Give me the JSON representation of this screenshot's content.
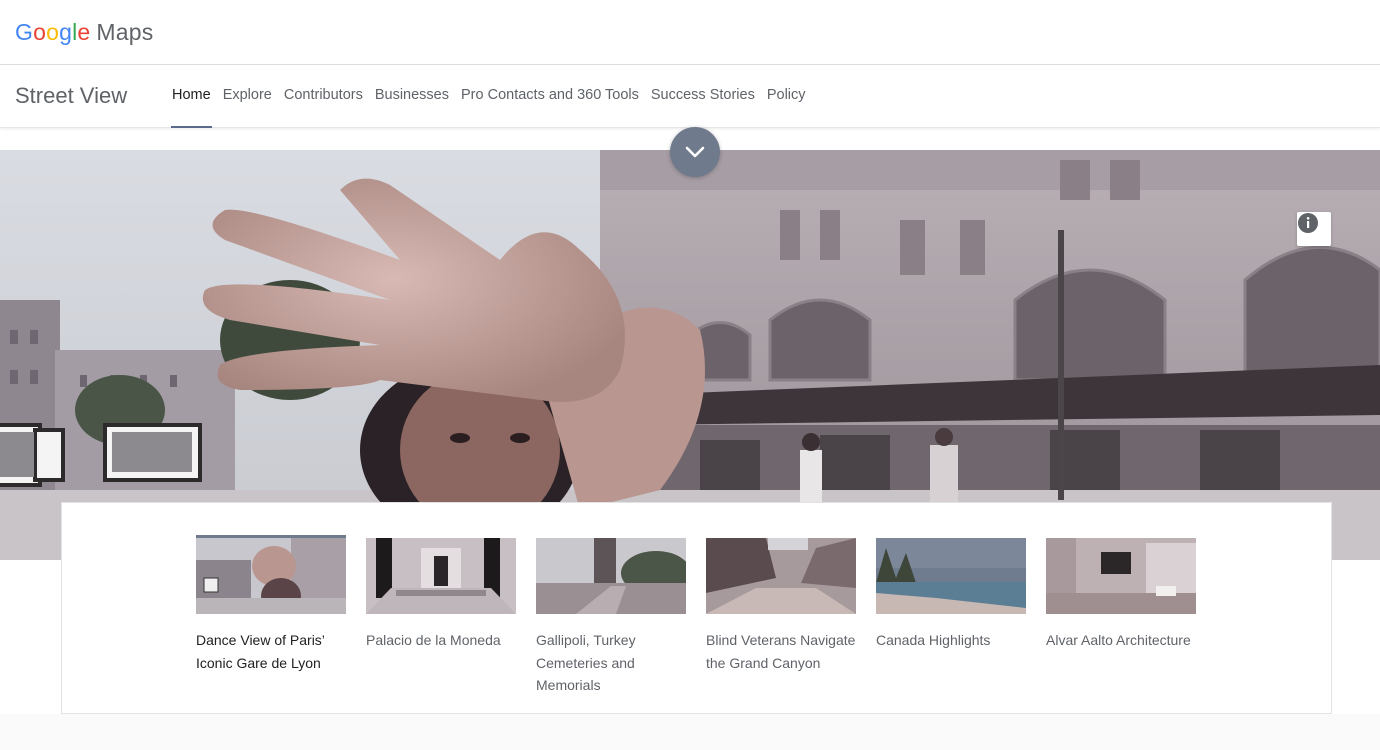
{
  "header": {
    "logo_letters": [
      "G",
      "o",
      "o",
      "g",
      "l",
      "e"
    ],
    "logo_suffix": "Maps"
  },
  "nav": {
    "product_title": "Street View",
    "tabs": [
      {
        "label": "Home",
        "active": true
      },
      {
        "label": "Explore",
        "active": false
      },
      {
        "label": "Contributors",
        "active": false
      },
      {
        "label": "Businesses",
        "active": false
      },
      {
        "label": "Pro Contacts and 360 Tools",
        "active": false
      },
      {
        "label": "Success Stories",
        "active": false
      },
      {
        "label": "Policy",
        "active": false
      }
    ]
  },
  "hero": {
    "scroll_icon": "chevron-down-icon",
    "info_icon": "info-icon"
  },
  "gallery": {
    "items": [
      {
        "caption": "Dance View of Paris’ Iconic Gare de Lyon",
        "active": true
      },
      {
        "caption": "Palacio de la Moneda",
        "active": false
      },
      {
        "caption": "Gallipoli, Turkey Cemeteries and Memorials",
        "active": false
      },
      {
        "caption": "Blind Veterans Navigate the Grand Canyon",
        "active": false
      },
      {
        "caption": "Canada Highlights",
        "active": false
      },
      {
        "caption": "Alvar Aalto Architecture",
        "active": false
      }
    ]
  },
  "colors": {
    "accent": "#5b6a8c",
    "text_primary": "#202124",
    "text_secondary": "#5f6368"
  }
}
